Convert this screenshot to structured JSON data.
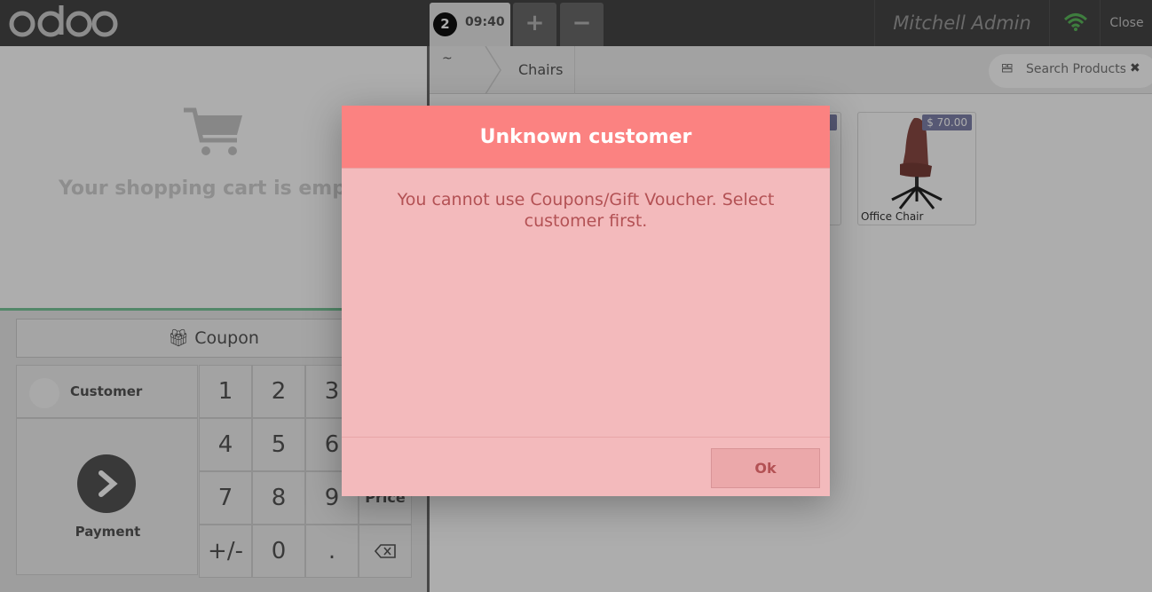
{
  "header": {
    "logo_text": "odoo",
    "ticket_number": "2",
    "ticket_time": "09:40",
    "add_order_label": "+",
    "remove_order_label": "−",
    "user_name": "Mitchell Admin",
    "wifi_icon": "wifi-icon",
    "wifi_color": "#5cb85c",
    "close_label": "Close"
  },
  "cart": {
    "empty_message": "Your shopping cart is empty"
  },
  "controls": {
    "coupon_label": "Coupon",
    "customer_label": "Customer",
    "payment_label": "Payment",
    "numpad": {
      "k1": "1",
      "k2": "2",
      "k3": "3",
      "k4": "4",
      "k5": "5",
      "k6": "6",
      "k7": "7",
      "k8": "8",
      "k9": "9",
      "plus_minus": "+/-",
      "k0": "0",
      "dot": ".",
      "price_mode": "Price"
    }
  },
  "products": {
    "breadcrumb_home": "~",
    "breadcrumb_category": "Chairs",
    "search_placeholder": "Search Products...",
    "items": [
      {
        "name": "Office Chair",
        "price": "$ 70.00"
      }
    ]
  },
  "modal": {
    "title": "Unknown customer",
    "body": "You cannot use Coupons/Gift Voucher. Select customer first.",
    "ok_label": "Ok",
    "header_color": "#fb8281",
    "body_color": "#f3babc"
  }
}
